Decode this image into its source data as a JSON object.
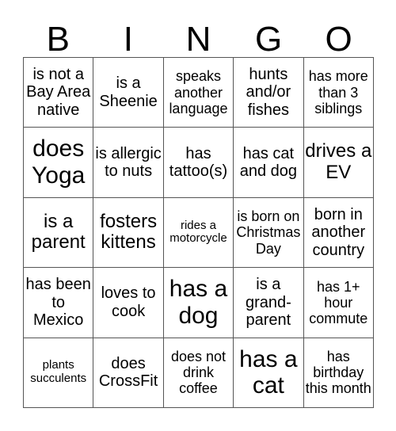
{
  "header": {
    "letters": [
      "B",
      "I",
      "N",
      "G",
      "O"
    ]
  },
  "card": {
    "rows": [
      [
        "is not a Bay Area native",
        "is a Sheenie",
        "speaks another language",
        "hunts and/or fishes",
        "has more than 3 siblings"
      ],
      [
        "does Yoga",
        "is allergic to nuts",
        "has tattoo(s)",
        "has cat and dog",
        "drives a EV"
      ],
      [
        "is a parent",
        "fosters kittens",
        "rides a motorcycle",
        "is born on Christmas Day",
        "born in another country"
      ],
      [
        "has been to Mexico",
        "loves to cook",
        "has a dog",
        "is a grand-parent",
        "has 1+ hour commute"
      ],
      [
        "plants succulents",
        "does CrossFit",
        "does not drink coffee",
        "has a cat",
        "has birthday this month"
      ]
    ]
  }
}
